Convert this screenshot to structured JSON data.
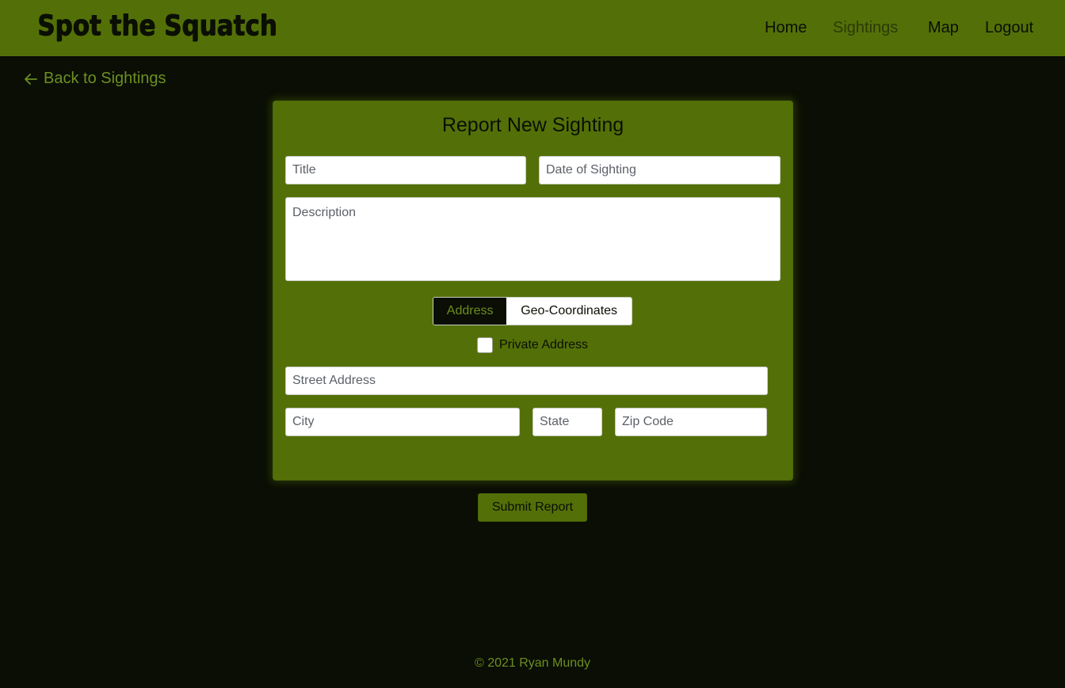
{
  "navbar": {
    "brand": "Spot the Squatch",
    "links": [
      {
        "label": "Home",
        "active": false
      },
      {
        "label": "Sightings",
        "active": true
      },
      {
        "label": "Map",
        "active": false
      },
      {
        "label": "Logout",
        "active": false
      }
    ]
  },
  "back_link": {
    "label": "Back to Sightings",
    "icon": "arrow-left-icon"
  },
  "form": {
    "title": "Report New Sighting",
    "title_placeholder": "Title",
    "date_placeholder": "Date of Sighting",
    "description_placeholder": "Description",
    "location_toggle": {
      "options": [
        "Address",
        "Geo-Coordinates"
      ],
      "selected": "Address"
    },
    "private_address_label": "Private Address",
    "private_address_checked": false,
    "street_placeholder": "Street Address",
    "city_placeholder": "City",
    "state_placeholder": "State",
    "zip_placeholder": "Zip Code"
  },
  "submit_label": "Submit Report",
  "footer": "© 2021 Ryan Mundy",
  "colors": {
    "navbar": "#537008",
    "background": "#0a0e04",
    "accent": "#6d8f1f",
    "text_dark": "#0b0f03"
  }
}
